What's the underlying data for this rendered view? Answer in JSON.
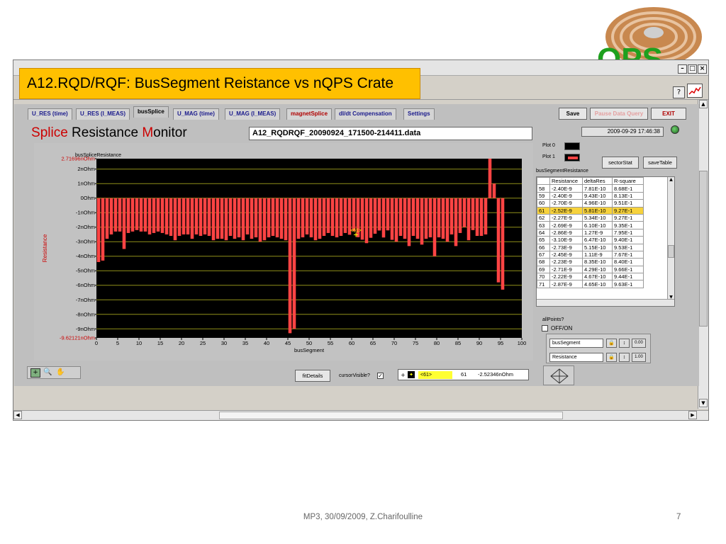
{
  "slide": {
    "title": "A12.RQD/RQF: BusSegment Reistance vs nQPS Crate",
    "footer": "MP3, 30/09/2009, Z.Charifoulline",
    "page_number": "7",
    "logo": "QPS"
  },
  "tabs": [
    {
      "label": "U_RES (time)"
    },
    {
      "label": "U_RES (I_MEAS)"
    },
    {
      "label": "busSplice"
    },
    {
      "label": "U_MAG (time)"
    },
    {
      "label": "U_MAG (I_MEAS)"
    },
    {
      "label": "magnetSplice"
    },
    {
      "label": "dI/dt Compensation"
    },
    {
      "label": "Settings"
    }
  ],
  "controls": {
    "save_label": "Save",
    "pause_label": "Pause Data Query",
    "exit_label": "EXIT"
  },
  "monitor": {
    "title_part1": "S",
    "title_part2": "plice",
    "title_part3": " Resistance ",
    "title_part4": "M",
    "title_part5": "onitor",
    "file_name": "A12_RQDRQF_20090924_171500-214411.data",
    "datetime": "2009-09-29 17:46:38"
  },
  "chart_data": {
    "type": "bar",
    "title": "busSpliceResistance",
    "xlabel": "busSegment",
    "ylabel": "Resistance",
    "xlim": [
      0,
      100
    ],
    "ylim": [
      -9.62121,
      2.71696
    ],
    "y_unit": "nOhm",
    "ytick_labels": [
      "2.71696nOhm",
      "2nOhm",
      "1nOhm",
      "0Ohm",
      "-1nOhm",
      "-2nOhm",
      "-3nOhm",
      "-4nOhm",
      "-5nOhm",
      "-6nOhm",
      "-7nOhm",
      "-8nOhm",
      "-9nOhm",
      "-9.62121nOhm"
    ],
    "ytick_values": [
      2.71696,
      2,
      1,
      0,
      -1,
      -2,
      -3,
      -4,
      -5,
      -6,
      -7,
      -8,
      -9,
      -9.62121
    ],
    "xtick_labels": [
      "0",
      "5",
      "10",
      "15",
      "20",
      "25",
      "30",
      "35",
      "40",
      "45",
      "50",
      "55",
      "60",
      "65",
      "70",
      "75",
      "80",
      "85",
      "90",
      "95",
      "100"
    ],
    "series": [
      {
        "values": [
          -4.4,
          -4.3,
          -2.8,
          -2.5,
          -2.3,
          -2.3,
          -3.5,
          -2.4,
          -2.3,
          -2.2,
          -2.3,
          -2.3,
          -2.5,
          -2.4,
          -2.3,
          -2.4,
          -2.5,
          -2.6,
          -2.9,
          -2.6,
          -2.5,
          -2.5,
          -2.8,
          -2.5,
          -2.6,
          -2.5,
          -2.6,
          -2.9,
          -2.8,
          -2.8,
          -2.9,
          -2.6,
          -2.8,
          -2.7,
          -2.9,
          -2.5,
          -2.8,
          -2.7,
          -3.0,
          -2.9,
          -2.7,
          -2.6,
          -2.7,
          -2.8,
          -2.9,
          -9.3,
          -9.0,
          -2.8,
          -2.7,
          -2.5,
          -2.7,
          -2.9,
          -2.8,
          -2.6,
          -2.4,
          -2.6,
          -2.7,
          -2.6,
          -2.4,
          -2.52,
          -2.27,
          -2.69,
          -2.86,
          -3.1,
          -2.73,
          -2.45,
          -2.23,
          -2.71,
          -2.22,
          -2.87,
          -3.0,
          -2.6,
          -2.8,
          -3.3,
          -2.6,
          -2.8,
          -3.2,
          -2.8,
          -2.7,
          -4.0,
          -2.7,
          -2.8,
          -3.0,
          -2.5,
          -3.3,
          -2.4,
          -2.0,
          -2.9,
          -2.2,
          -2.6,
          -2.6,
          -2.5,
          2.72,
          1.0,
          -5.8,
          -6.3
        ]
      }
    ],
    "cursor": {
      "label": "<61>",
      "x": 61,
      "y": -2.52346
    },
    "grid": true
  },
  "plot_legend": {
    "plot0": "Plot 0",
    "plot1": "Plot 1"
  },
  "table": {
    "caption": "busSegmentResistance",
    "headers": [
      "",
      "Resistance",
      "deltaRes",
      "R-square"
    ],
    "rows": [
      [
        "58",
        "-2.40E-9",
        "7.81E-10",
        "8.68E-1"
      ],
      [
        "59",
        "-2.40E-9",
        "9.43E-10",
        "8.13E-1"
      ],
      [
        "60",
        "-2.70E-9",
        "4.96E-10",
        "9.51E-1"
      ],
      [
        "61",
        "-2.52E-9",
        "5.81E-10",
        "9.27E-1"
      ],
      [
        "62",
        "-2.27E-9",
        "5.34E-10",
        "9.27E-1"
      ],
      [
        "63",
        "-2.69E-9",
        "6.10E-10",
        "9.35E-1"
      ],
      [
        "64",
        "-2.86E-9",
        "1.27E-9",
        "7.95E-1"
      ],
      [
        "65",
        "-3.10E-9",
        "6.47E-10",
        "9.40E-1"
      ],
      [
        "66",
        "-2.73E-9",
        "5.15E-10",
        "9.53E-1"
      ],
      [
        "67",
        "-2.45E-9",
        "1.11E-9",
        "7.67E-1"
      ],
      [
        "68",
        "-2.23E-9",
        "8.35E-10",
        "8.40E-1"
      ],
      [
        "69",
        "-2.71E-9",
        "4.29E-10",
        "9.66E-1"
      ],
      [
        "70",
        "-2.22E-9",
        "4.67E-10",
        "9.44E-1"
      ],
      [
        "71",
        "-2.87E-9",
        "4.65E-10",
        "9.63E-1"
      ]
    ]
  },
  "buttons": {
    "sectorstat": "sectorStat",
    "savetable": "saveTable",
    "fitdetails": "fitDetails"
  },
  "allpoints": {
    "label": "allPoints?",
    "option": "OFF/ON"
  },
  "scale_legend": {
    "x_name": "busSegment",
    "y_name": "Resistance",
    "x_fmt": "0.00",
    "y_fmt": "1.00"
  },
  "cursor_panel": {
    "cursor_visible_label": "cursorVisible?",
    "cursor_name": "<61>",
    "cursor_x": "61",
    "cursor_y": "-2.52346nOhm"
  },
  "colors": {
    "bar": "#ff4444",
    "plot_bg": "#000000",
    "grid": "#8f8f1a",
    "highlight_row": "#f7d23c",
    "slide_title_bg": "#ffc000"
  }
}
